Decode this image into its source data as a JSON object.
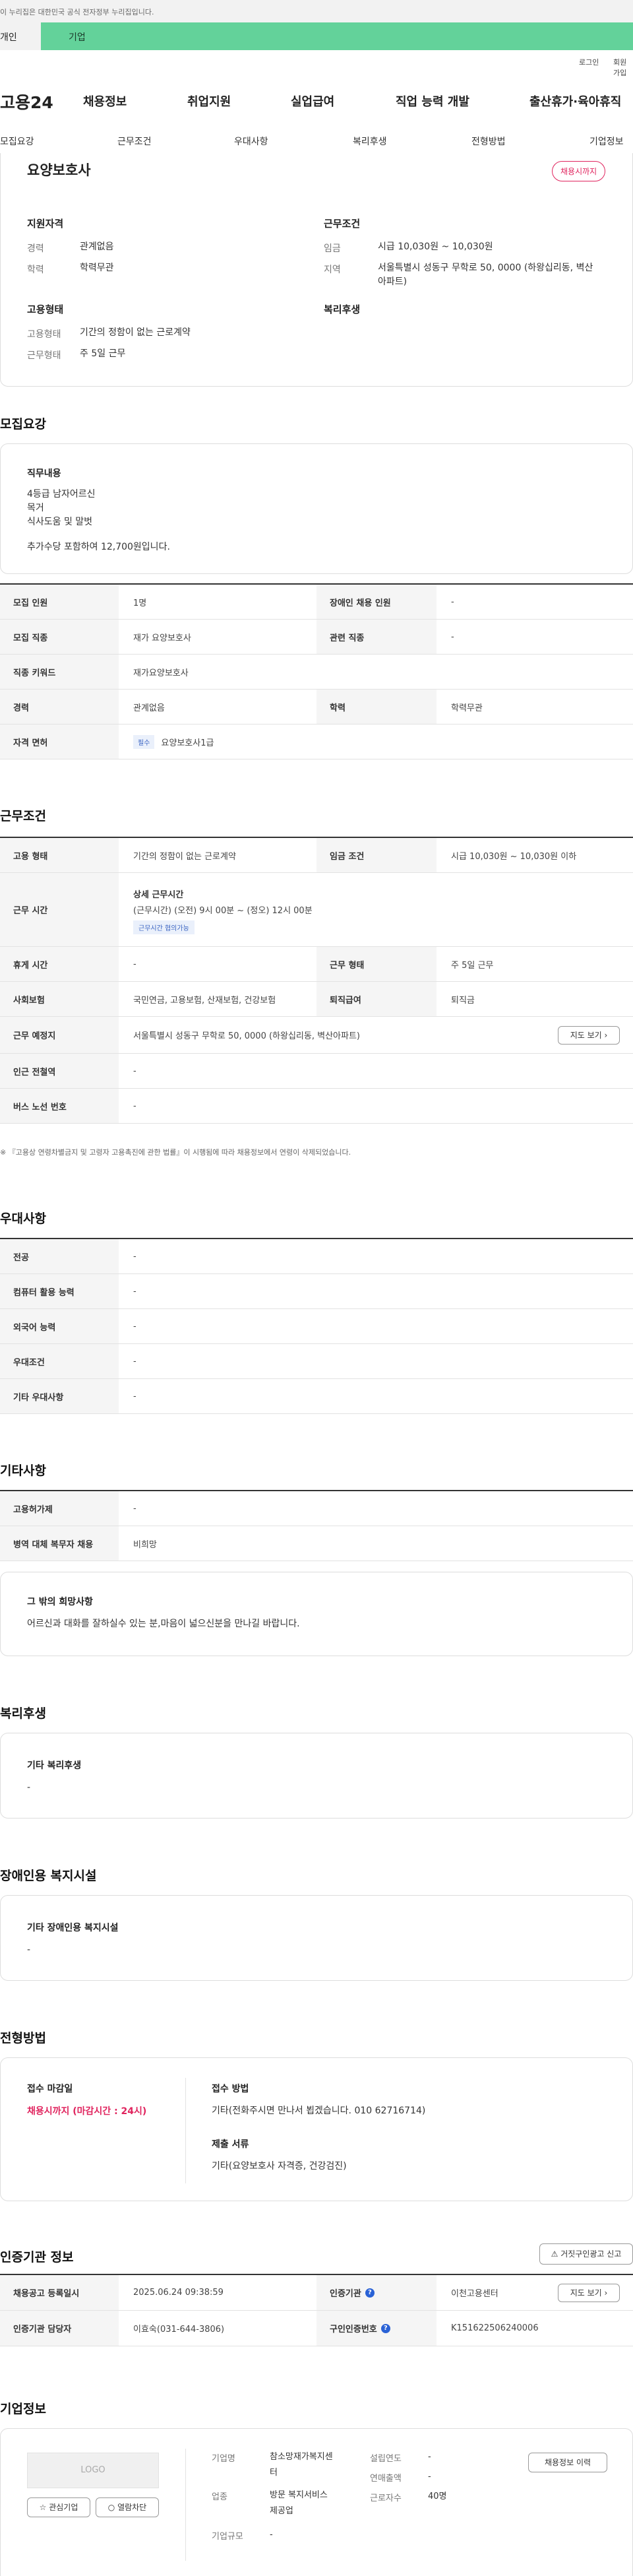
{
  "gov_notice": "이 누리집은 대한민국 공식 전자정부 누리집입니다.",
  "tabs": [
    "개인",
    "기업"
  ],
  "util": {
    "login": "로그인",
    "join": "회원가입"
  },
  "logo": "고용24",
  "gnb": [
    "채용정보",
    "취업지원",
    "실업급여",
    "직업 능력 개발",
    "출산휴가·육아휴직"
  ],
  "subnav": [
    "모집요강",
    "근무조건",
    "우대사항",
    "복리후생",
    "전형방법",
    "기업정보"
  ],
  "summary": {
    "title": "요양보호사",
    "deadline_badge": "채용시까지",
    "qual_title": "지원자격",
    "qual": [
      {
        "k": "경력",
        "v": "관계없음"
      },
      {
        "k": "학력",
        "v": "학력무관"
      }
    ],
    "cond_title": "근무조건",
    "cond": [
      {
        "k": "임금",
        "v": "시급 10,030원 ~ 10,030원"
      },
      {
        "k": "지역",
        "v1": "서울특별시 성동구 무학로 50, 0000 (하왕십리동, 벽산",
        "v2": "아파트)"
      }
    ],
    "emp_title": "고용형태",
    "emp": [
      {
        "k": "고용형태",
        "v": "기간의 정함이 없는 근로계약"
      },
      {
        "k": "근무형태",
        "v": "주 5일 근무"
      }
    ],
    "welfare_title": "복리후생"
  },
  "recruit": {
    "heading": "모집요강",
    "duty_title": "직무내용",
    "duty_lines": [
      "4등급 남자어르신",
      "목거",
      "식사도움 및 말벗",
      "추가수당 포함하여 12,700원입니다."
    ],
    "rows": [
      {
        "a": "모집 인원",
        "b": "1명",
        "c": "장애인 채용 인원",
        "d": "-"
      },
      {
        "a": "모집 직종",
        "b": "재가 요양보호사",
        "c": "관련 직종",
        "d": "-"
      },
      {
        "a": "직종 키워드",
        "b": "재가요양보호사"
      },
      {
        "a": "경력",
        "b": "관계없음",
        "c": "학력",
        "d": "학력무관"
      },
      {
        "a": "자격 면허",
        "tag": "필수",
        "b": "요양보호사1급"
      }
    ]
  },
  "work": {
    "heading": "근무조건",
    "rows": [
      {
        "a": "고용 형태",
        "b": "기간의 정함이 없는 근로계약",
        "c": "임금 조건",
        "d": "시급 10,030원 ~ 10,030원 이하"
      },
      {
        "a": "근무 시간",
        "title": "상세 근무시간",
        "b": "(근무시간) (오전) 9시 00분 ~ (정오) 12시 00분",
        "tag": "근무시간 협의가능"
      },
      {
        "a": "휴게 시간",
        "b": "-",
        "c": "근무 형태",
        "d": "주 5일 근무"
      },
      {
        "a": "사회보험",
        "b": "국민연금, 고용보험, 산재보험, 건강보험",
        "c": "퇴직급여",
        "d": "퇴직금"
      },
      {
        "a": "근무 예정지",
        "b": "서울특별시 성동구 무학로 50, 0000 (하왕십리동, 벽산아파트)",
        "btn": "지도 보기"
      },
      {
        "a": "인근 전철역",
        "b": "-"
      },
      {
        "a": "버스 노선 번호",
        "b": "-"
      }
    ],
    "notice": "※ 『고용상 연령차별금지 및 고령자 고용촉진에 관한 법률』이 시행됨에 따라 채용정보에서 연령이 삭제되었습니다."
  },
  "pref": {
    "heading": "우대사항",
    "rows": [
      {
        "a": "전공",
        "b": "-"
      },
      {
        "a": "컴퓨터 활용 능력",
        "b": "-"
      },
      {
        "a": "외국어 능력",
        "b": "-"
      },
      {
        "a": "우대조건",
        "b": "-"
      },
      {
        "a": "기타 우대사항",
        "b": "-"
      }
    ]
  },
  "etc": {
    "heading": "기타사항",
    "rows": [
      {
        "a": "고용허가제",
        "b": "-"
      },
      {
        "a": "병역 대체 복무자 채용",
        "b": "비희망"
      }
    ],
    "box_title": "그 밖의 희망사항",
    "box_text": "어르신과 대화를 잘하실수 있는 분,마음이 넓으신분을 만나길 바랍니다."
  },
  "benefit": {
    "heading": "복리후생",
    "title": "기타 복리후생",
    "val": "-"
  },
  "disabled": {
    "heading": "장애인용 복지시설",
    "title": "기타 장애인용 복지시설",
    "val": "-"
  },
  "selection": {
    "heading": "전형방법",
    "deadline_title": "접수 마감일",
    "deadline_val": "채용시까지 (마감시간 : 24시)",
    "method_title": "접수 방법",
    "method_val": "기타(전화주시면 만나서 뵙겠습니다. 010 62716714)",
    "docs_title": "제출 서류",
    "docs_val": "기타(요양보호사 자격증, 건강검진)"
  },
  "cert": {
    "heading": "인증기관 정보",
    "report_btn": "거짓구인광고 신고",
    "rows": [
      {
        "a": "채용공고 등록일시",
        "b": "2025.06.24 09:38:59",
        "c": "인증기관",
        "d": "이천고용센터",
        "btn": "지도 보기"
      },
      {
        "a": "인증기관 담당자",
        "b": "이효숙(031-644-3806)",
        "c": "구인인증번호",
        "d": "K151622506240006"
      }
    ]
  },
  "company": {
    "heading": "기업정보",
    "logo_text": "LOGO",
    "btn_fav": "관심기업",
    "btn_block": "열람차단",
    "name_k": "기업명",
    "name_v1": "참소망재가복지센",
    "name_v2": "터",
    "ind_k": "업종",
    "ind_v1": "방문 복지서비스",
    "ind_v2": "제공업",
    "size_k": "기업규모",
    "size_v": "-",
    "year_k": "설립연도",
    "year_v": "-",
    "sales_k": "연매출액",
    "sales_v": "-",
    "emp_k": "근로자수",
    "emp_v": "40명",
    "jobs_btn": "채용정보 이력"
  }
}
